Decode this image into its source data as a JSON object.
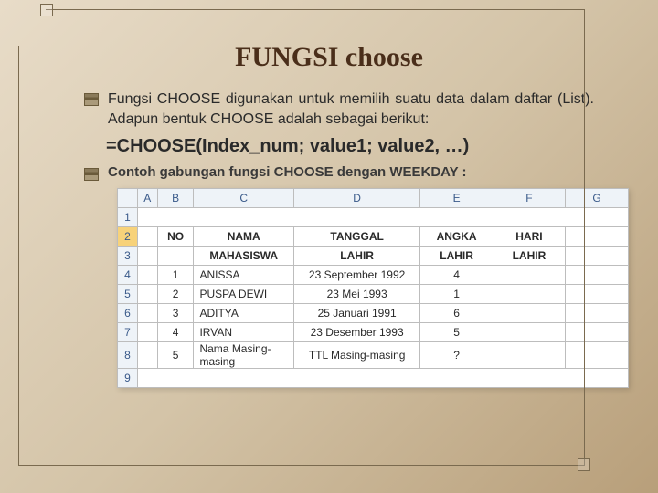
{
  "title": "FUNGSI choose",
  "para1": "Fungsi CHOOSE digunakan untuk memilih suatu data dalam daftar (List). Adapun bentuk CHOOSE adalah sebagai berikut:",
  "formula": "=CHOOSE(Index_num; value1; value2, …)",
  "para2": "Contoh gabungan fungsi CHOOSE dengan WEEKDAY :",
  "sheet": {
    "cols": [
      "A",
      "B",
      "C",
      "D",
      "E",
      "F",
      "G"
    ],
    "rownums": [
      "1",
      "2",
      "3",
      "4",
      "5",
      "6",
      "7",
      "8",
      "9"
    ],
    "header1": [
      "",
      "NO",
      "NAMA",
      "TANGGAL",
      "ANGKA",
      "HARI",
      ""
    ],
    "header2": [
      "",
      "",
      "MAHASISWA",
      "LAHIR",
      "LAHIR",
      "LAHIR",
      ""
    ],
    "rows": [
      [
        "",
        "1",
        "ANISSA",
        "23 September 1992",
        "4",
        "",
        ""
      ],
      [
        "",
        "2",
        "PUSPA DEWI",
        "23 Mei 1993",
        "1",
        "",
        ""
      ],
      [
        "",
        "3",
        "ADITYA",
        "25 Januari 1991",
        "6",
        "",
        ""
      ],
      [
        "",
        "4",
        "IRVAN",
        "23 Desember 1993",
        "5",
        "",
        ""
      ],
      [
        "",
        "5",
        "Nama Masing-masing",
        "TTL Masing-masing",
        "?",
        "",
        ""
      ]
    ]
  }
}
